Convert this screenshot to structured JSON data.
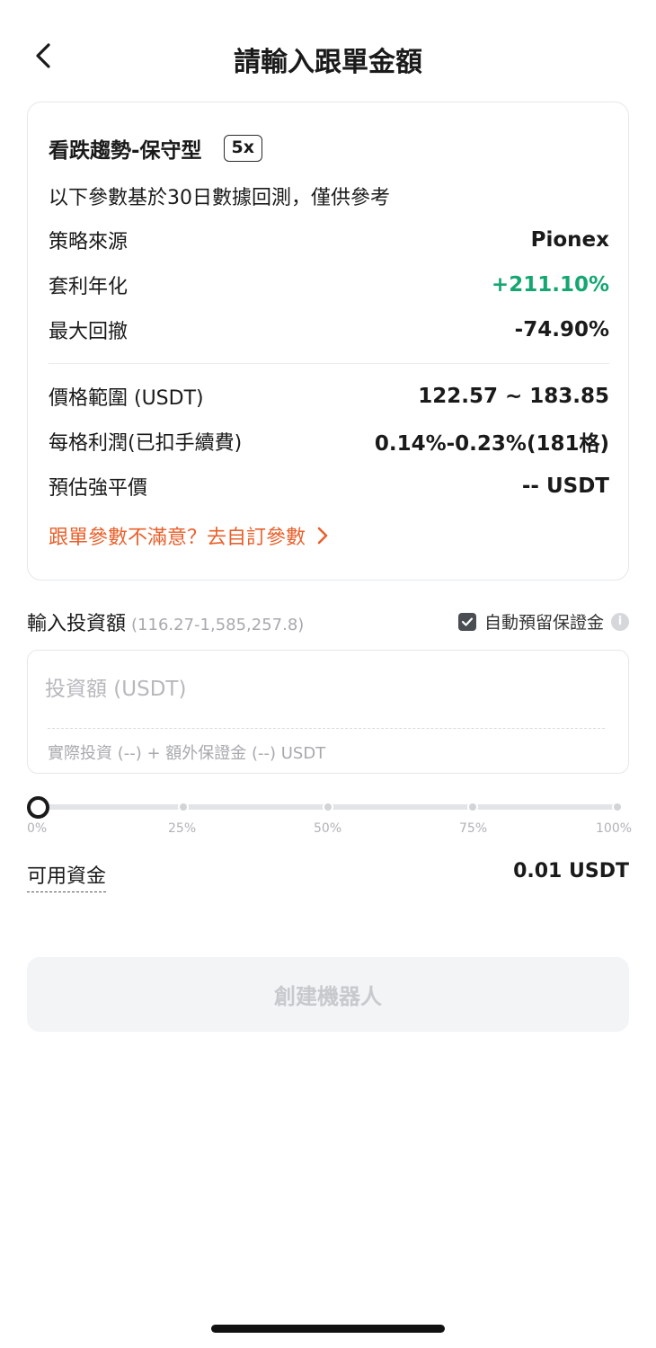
{
  "header": {
    "title": "請輸入跟單金額"
  },
  "strategy": {
    "title": "看跌趨勢-保守型",
    "leverage": "5x",
    "note": "以下參數基於30日數據回測，僅供參考",
    "rows": [
      {
        "label": "策略來源",
        "value": "Pionex"
      },
      {
        "label": "套利年化",
        "value": "+211.10%"
      },
      {
        "label": "最大回撤",
        "value": "-74.90%"
      },
      {
        "label": "價格範圍 (USDT)",
        "value": "122.57 ~ 183.85"
      },
      {
        "label": "每格利潤(已扣手續費)",
        "value": "0.14%-0.23%(181格)"
      },
      {
        "label": "預估強平價",
        "value": "-- USDT"
      }
    ],
    "custom_link": "跟單參數不滿意？去自訂參數",
    "positive_color": "#16a672",
    "link_color": "#e8612c"
  },
  "invest": {
    "label": "輸入投資額",
    "range": "(116.27-1,585,257.8)",
    "auto_margin_label": "自動預留保證金",
    "auto_margin_checked": true,
    "placeholder": "投資額 (USDT)",
    "breakdown": "實際投資 (--) + 額外保證金  (--) USDT"
  },
  "slider": {
    "value_percent": 0,
    "ticks": [
      "0%",
      "25%",
      "50%",
      "75%",
      "100%"
    ]
  },
  "available": {
    "label": "可用資金",
    "value": "0.01 USDT"
  },
  "create_button": {
    "label": "創建機器人",
    "enabled": false
  }
}
